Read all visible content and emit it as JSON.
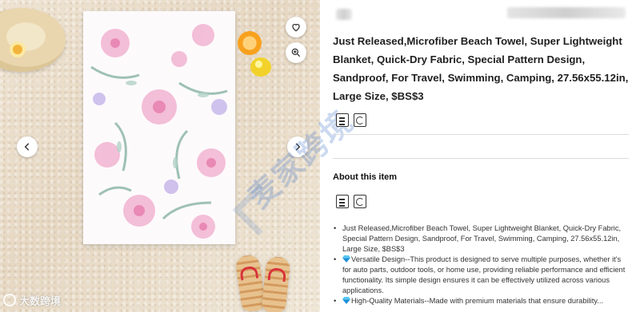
{
  "colors": {
    "accent_gem": "#1e90d6",
    "title_text": "#1f1f1f",
    "body_text": "#333333",
    "watermark": "#4678c8"
  },
  "gallery": {
    "heart_icon": "heart-icon",
    "zoom_icon": "zoom-in-icon",
    "prev_icon": "chevron-left-icon",
    "next_icon": "chevron-right-icon",
    "watermark_brand": "大数跨境",
    "diagonal_watermark": "麦家跨境"
  },
  "product": {
    "title": "Just Released,Microfiber Beach Towel, Super Lightweight Blanket, Quick-Dry Fabric, Special Pattern Design, Sandproof, For Travel, Swimming, Camping, 27.56x55.12in, Large Size, $BS$3"
  },
  "about": {
    "heading": "About this item",
    "bullets": [
      {
        "has_gem": false,
        "text": "Just Released,Microfiber Beach Towel, Super Lightweight Blanket, Quick-Dry Fabric, Special Pattern Design, Sandproof, For Travel, Swimming, Camping, 27.56x55.12in, Large Size, $BS$3"
      },
      {
        "has_gem": true,
        "text": "Versatile Design--This product is designed to serve multiple purposes, whether it's for auto parts, outdoor tools, or home use, providing reliable performance and efficient functionality. Its simple design ensures it can be effectively utilized across various applications."
      },
      {
        "has_gem": true,
        "text": "High-Quality Materials--Made with premium materials that ensure durability..."
      }
    ]
  }
}
